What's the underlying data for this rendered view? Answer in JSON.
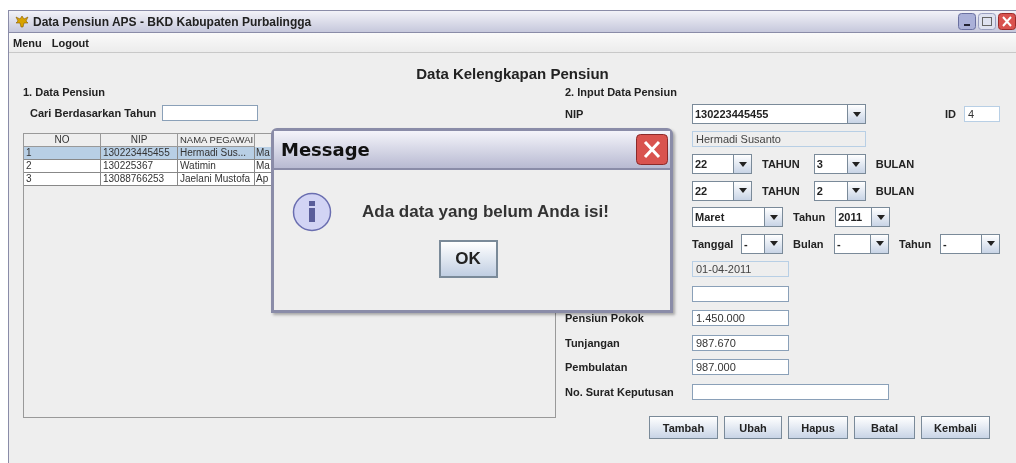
{
  "window": {
    "title": "Data Pensiun APS - BKD Kabupaten Purbalingga"
  },
  "menu": [
    {
      "label": "Menu"
    },
    {
      "label": "Logout"
    }
  ],
  "heading": "Data Kelengkapan Pensiun",
  "pension_list": {
    "title": "1. Data Pensiun",
    "search_label": "Cari Berdasarkan Tahun",
    "table": {
      "columns": [
        "NO",
        "NIP",
        "NAMA PEGAWAI"
      ],
      "rows": [
        {
          "cells": [
            "1",
            "130223445455",
            "Hermadi Sus...",
            "Ma"
          ],
          "selected": true
        },
        {
          "cells": [
            "2",
            "130225367",
            "Watimin",
            "Ma"
          ],
          "selected": false
        },
        {
          "cells": [
            "3",
            "13088766253",
            "Jaelani Mustofa",
            "Ap"
          ],
          "selected": false
        }
      ]
    }
  },
  "form": {
    "title": "2. Input Data Pensiun",
    "nip": {
      "label": "NIP",
      "value": "130223445455"
    },
    "id": {
      "label": "ID",
      "value": "4"
    },
    "name": {
      "value": "Hermadi Susanto",
      "disabled": true
    },
    "service": [
      {
        "years": "22",
        "years_unit": "TAHUN",
        "months": "3",
        "months_unit": "BULAN"
      },
      {
        "years": "22",
        "years_unit": "TAHUN",
        "months": "2",
        "months_unit": "BULAN"
      }
    ],
    "period": {
      "month": "Maret",
      "year_label": "Tahun",
      "year": "2011"
    },
    "date": {
      "day_label": "Tanggal",
      "day": "-",
      "month_label": "Bulan",
      "month": "-",
      "year_label": "Tahun",
      "year": "-"
    },
    "fields": [
      {
        "value": "01-04-2011",
        "disabled": true,
        "kind": "narrow"
      },
      {
        "disabled": false,
        "kind": "narrow"
      },
      {
        "label": "Pensiun Pokok",
        "value": "1.450.000",
        "disabled": false,
        "kind": "narrow"
      },
      {
        "label": "Tunjangan",
        "value": "987.670",
        "disabled": false,
        "kind": "narrow"
      },
      {
        "label": "Pembulatan",
        "value": "987.000",
        "disabled": false,
        "kind": "narrow"
      },
      {
        "label": "No. Surat Keputusan",
        "disabled": false,
        "kind": "wide"
      }
    ],
    "buttons": [
      "Tambah",
      "Ubah",
      "Hapus",
      "Batal",
      "Kembali"
    ]
  },
  "dialog": {
    "title": "Message",
    "message": "Ada data yang belum Anda isi!",
    "button": "OK"
  }
}
